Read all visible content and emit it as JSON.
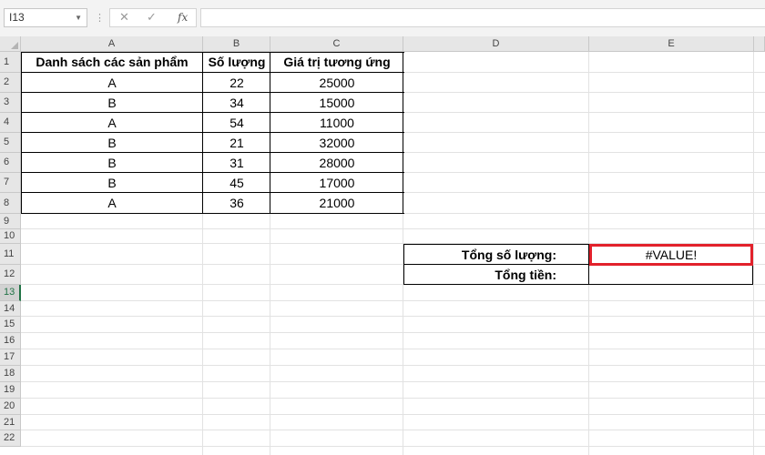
{
  "formula_bar": {
    "name_box": "I13",
    "cancel_icon": "close-icon",
    "enter_icon": "check-icon",
    "function_label": "fx",
    "formula": ""
  },
  "columns": [
    "A",
    "B",
    "C",
    "D",
    "E"
  ],
  "rows": [
    "1",
    "2",
    "3",
    "4",
    "5",
    "6",
    "7",
    "8",
    "9",
    "10",
    "11",
    "12",
    "13",
    "14",
    "15",
    "16",
    "17",
    "18",
    "19",
    "20",
    "21",
    "22"
  ],
  "active_row": "13",
  "table": {
    "headers": [
      "Danh sách các sản phẩm",
      "Số lượng",
      "Giá trị tương ứng"
    ],
    "rows": [
      [
        "A",
        "22",
        "25000"
      ],
      [
        "B",
        "34",
        "15000"
      ],
      [
        "A",
        "54",
        "11000"
      ],
      [
        "B",
        "21",
        "32000"
      ],
      [
        "B",
        "31",
        "28000"
      ],
      [
        "B",
        "45",
        "17000"
      ],
      [
        "A",
        "36",
        "21000"
      ]
    ]
  },
  "summary": {
    "total_qty_label": "Tổng số lượng:",
    "total_qty_value": "#VALUE!",
    "total_money_label": "Tổng tiền:",
    "total_money_value": ""
  },
  "colors": {
    "accent": "#217346",
    "highlight": "#e2212b"
  }
}
